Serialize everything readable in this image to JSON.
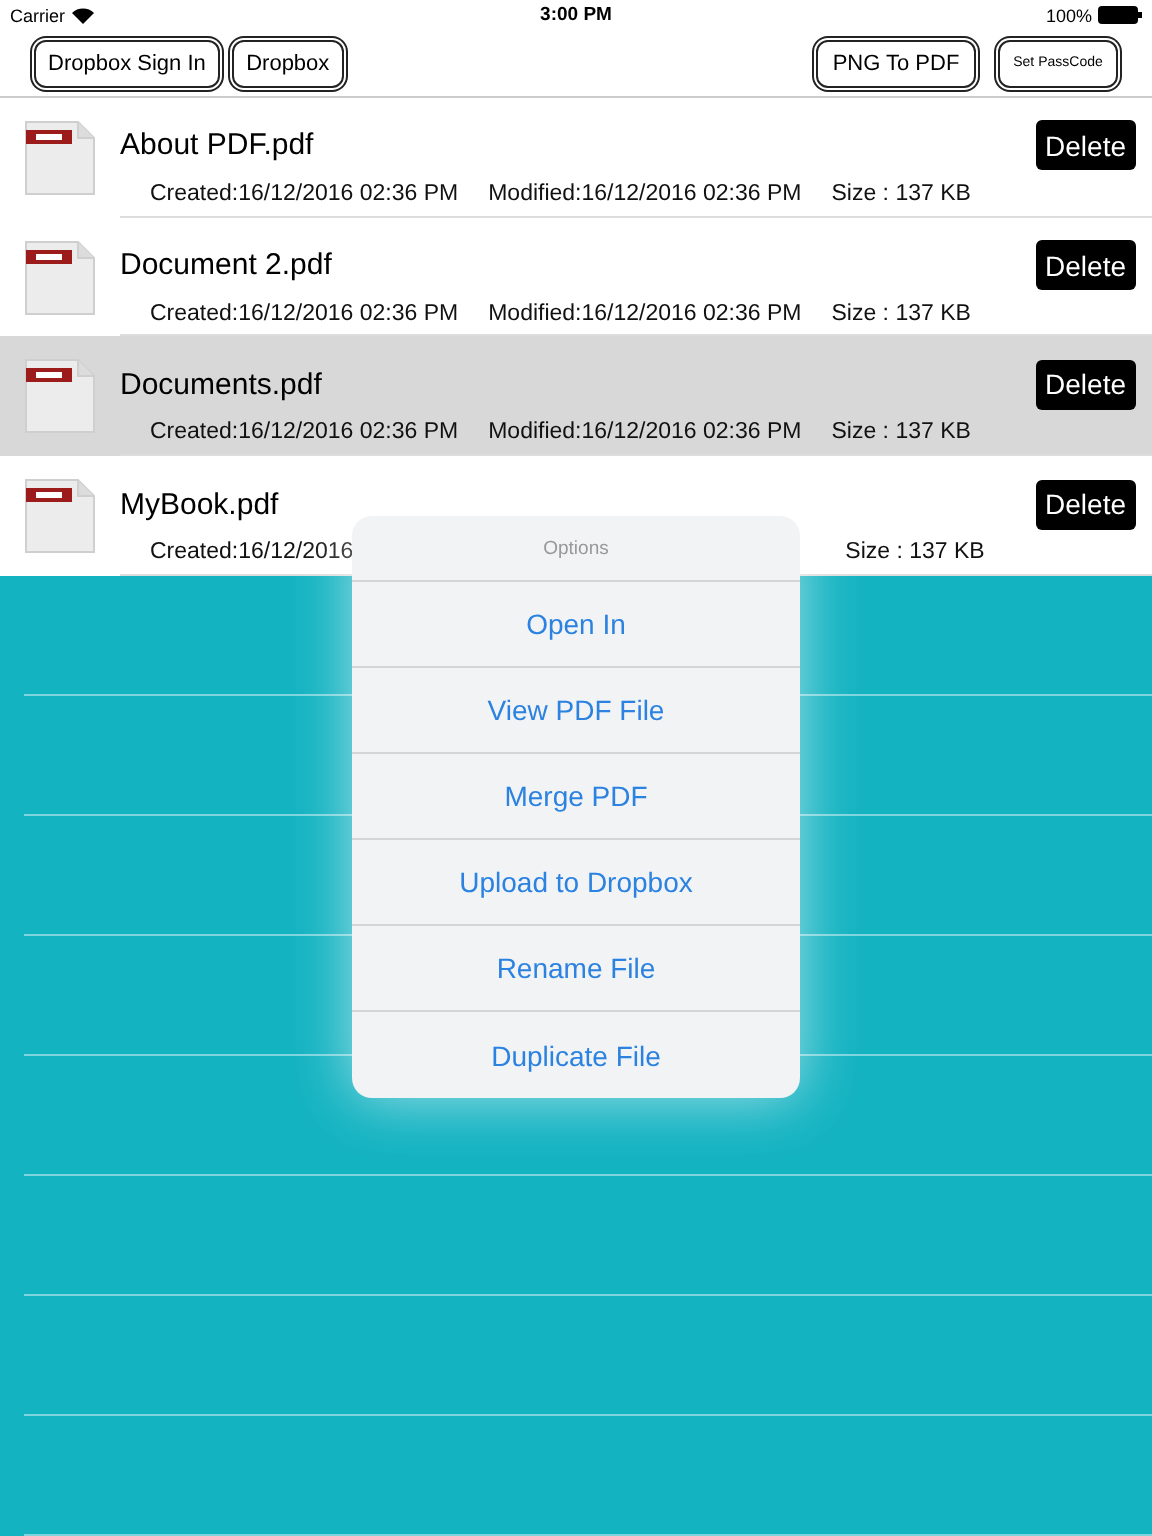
{
  "status_bar": {
    "carrier": "Carrier",
    "time": "3:00 PM",
    "battery": "100%"
  },
  "toolbar": {
    "left_buttons": [
      "Dropbox Sign In",
      "Dropbox"
    ],
    "right_buttons": [
      {
        "label": "PNG To PDF",
        "kind": "normal"
      },
      {
        "label": "Set PassCode",
        "kind": "small"
      }
    ]
  },
  "files": [
    {
      "name": "About PDF.pdf",
      "created": "Created:16/12/2016 02:36 PM",
      "modified": "Modified:16/12/2016 02:36 PM",
      "size": "Size : 137 KB",
      "delete": "Delete",
      "selected": false
    },
    {
      "name": "Document 2.pdf",
      "created": "Created:16/12/2016 02:36 PM",
      "modified": "Modified:16/12/2016 02:36 PM",
      "size": "Size : 137 KB",
      "delete": "Delete",
      "selected": false
    },
    {
      "name": "Documents.pdf",
      "created": "Created:16/12/2016 02:36 PM",
      "modified": "Modified:16/12/2016 02:36 PM",
      "size": "Size : 137 KB",
      "delete": "Delete",
      "selected": true
    },
    {
      "name": "MyBook.pdf",
      "created": "Created:16/12/2016",
      "size": "Size : 137 KB",
      "delete": "Delete",
      "selected": false
    }
  ],
  "options_popover": {
    "title": "Options",
    "items": [
      "Open In",
      "View PDF File",
      "Merge PDF",
      "Upload to Dropbox",
      "Rename File",
      "Duplicate File"
    ]
  }
}
